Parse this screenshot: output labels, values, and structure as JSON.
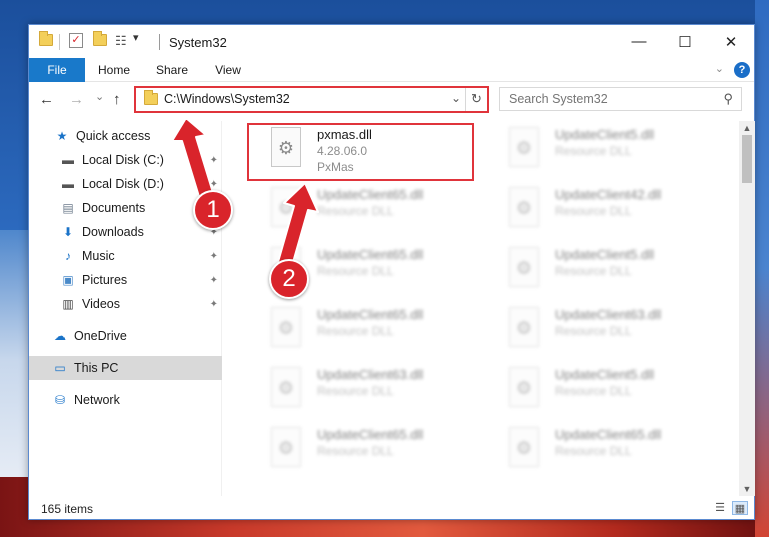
{
  "window": {
    "title": "System32",
    "minimize_glyph": "—",
    "maximize_glyph": "☐",
    "close_glyph": "✕"
  },
  "ribbon": {
    "tabs": [
      "File",
      "Home",
      "Share",
      "View"
    ],
    "expand_glyph": "⌄",
    "help_glyph": "?"
  },
  "navigation": {
    "back_glyph": "←",
    "forward_glyph": "→",
    "recent_glyph": "⌄",
    "up_glyph": "↑",
    "address": "C:\\Windows\\System32",
    "dropdown_glyph": "⌄",
    "refresh_glyph": "↻",
    "search_placeholder": "Search System32",
    "search_glyph": "⚲"
  },
  "sidebar": {
    "items": [
      {
        "label": "Quick access",
        "icon": "star-icon",
        "glyph": "★",
        "color": "#1a73c8"
      },
      {
        "label": "Local Disk (C:)",
        "icon": "drive-icon",
        "glyph": "▬",
        "color": "#555555",
        "pinned": true
      },
      {
        "label": "Local Disk (D:)",
        "icon": "drive-icon",
        "glyph": "▬",
        "color": "#555555",
        "pinned": true
      },
      {
        "label": "Documents",
        "icon": "documents-icon",
        "glyph": "▤",
        "color": "#6d7b8c",
        "pinned": true
      },
      {
        "label": "Downloads",
        "icon": "download-icon",
        "glyph": "⬇",
        "color": "#1a73c8",
        "pinned": true
      },
      {
        "label": "Music",
        "icon": "music-icon",
        "glyph": "♪",
        "color": "#1a73c8",
        "pinned": true
      },
      {
        "label": "Pictures",
        "icon": "pictures-icon",
        "glyph": "▣",
        "color": "#4a8ac9",
        "pinned": true
      },
      {
        "label": "Videos",
        "icon": "videos-icon",
        "glyph": "▥",
        "color": "#444444",
        "pinned": true
      },
      {
        "label": "OneDrive",
        "icon": "cloud-icon",
        "glyph": "☁",
        "color": "#1a73c8"
      },
      {
        "label": "This PC",
        "icon": "computer-icon",
        "glyph": "▭",
        "color": "#1a73c8",
        "selected": true
      },
      {
        "label": "Network",
        "icon": "network-icon",
        "glyph": "⛁",
        "color": "#1a73c8"
      }
    ],
    "pin_glyph": "✦"
  },
  "files": {
    "gear_glyph": "⚙",
    "featured": {
      "name": "pxmas.dll",
      "version": "4.28.06.0",
      "company": "PxMas"
    },
    "left_column": [
      {
        "name": "UpdateClient65.dll",
        "type": "Resource DLL"
      },
      {
        "name": "UpdateClient65.dll",
        "type": "Resource DLL"
      },
      {
        "name": "UpdateClient65.dll",
        "type": "Resource DLL"
      },
      {
        "name": "UpdateClient63.dll",
        "type": "Resource DLL"
      },
      {
        "name": "UpdateClient65.dll",
        "type": "Resource DLL"
      }
    ],
    "right_column": [
      {
        "name": "UpdateClient5.dll",
        "type": "Resource DLL"
      },
      {
        "name": "UpdateClient42.dll",
        "type": "Resource DLL"
      },
      {
        "name": "UpdateClient5.dll",
        "type": "Resource DLL"
      },
      {
        "name": "UpdateClient63.dll",
        "type": "Resource DLL"
      },
      {
        "name": "UpdateClient5.dll",
        "type": "Resource DLL"
      },
      {
        "name": "UpdateClient65.dll",
        "type": "Resource DLL"
      }
    ]
  },
  "scrollbar": {
    "up_glyph": "▲",
    "down_glyph": "▼"
  },
  "status": {
    "item_count": "165 items",
    "details_view_glyph": "☰",
    "tiles_view_glyph": "▦"
  },
  "callouts": [
    {
      "number": "1"
    },
    {
      "number": "2"
    }
  ],
  "colors": {
    "accent": "#1979ca",
    "highlight": "#e0343b",
    "callout": "#d9242b"
  }
}
